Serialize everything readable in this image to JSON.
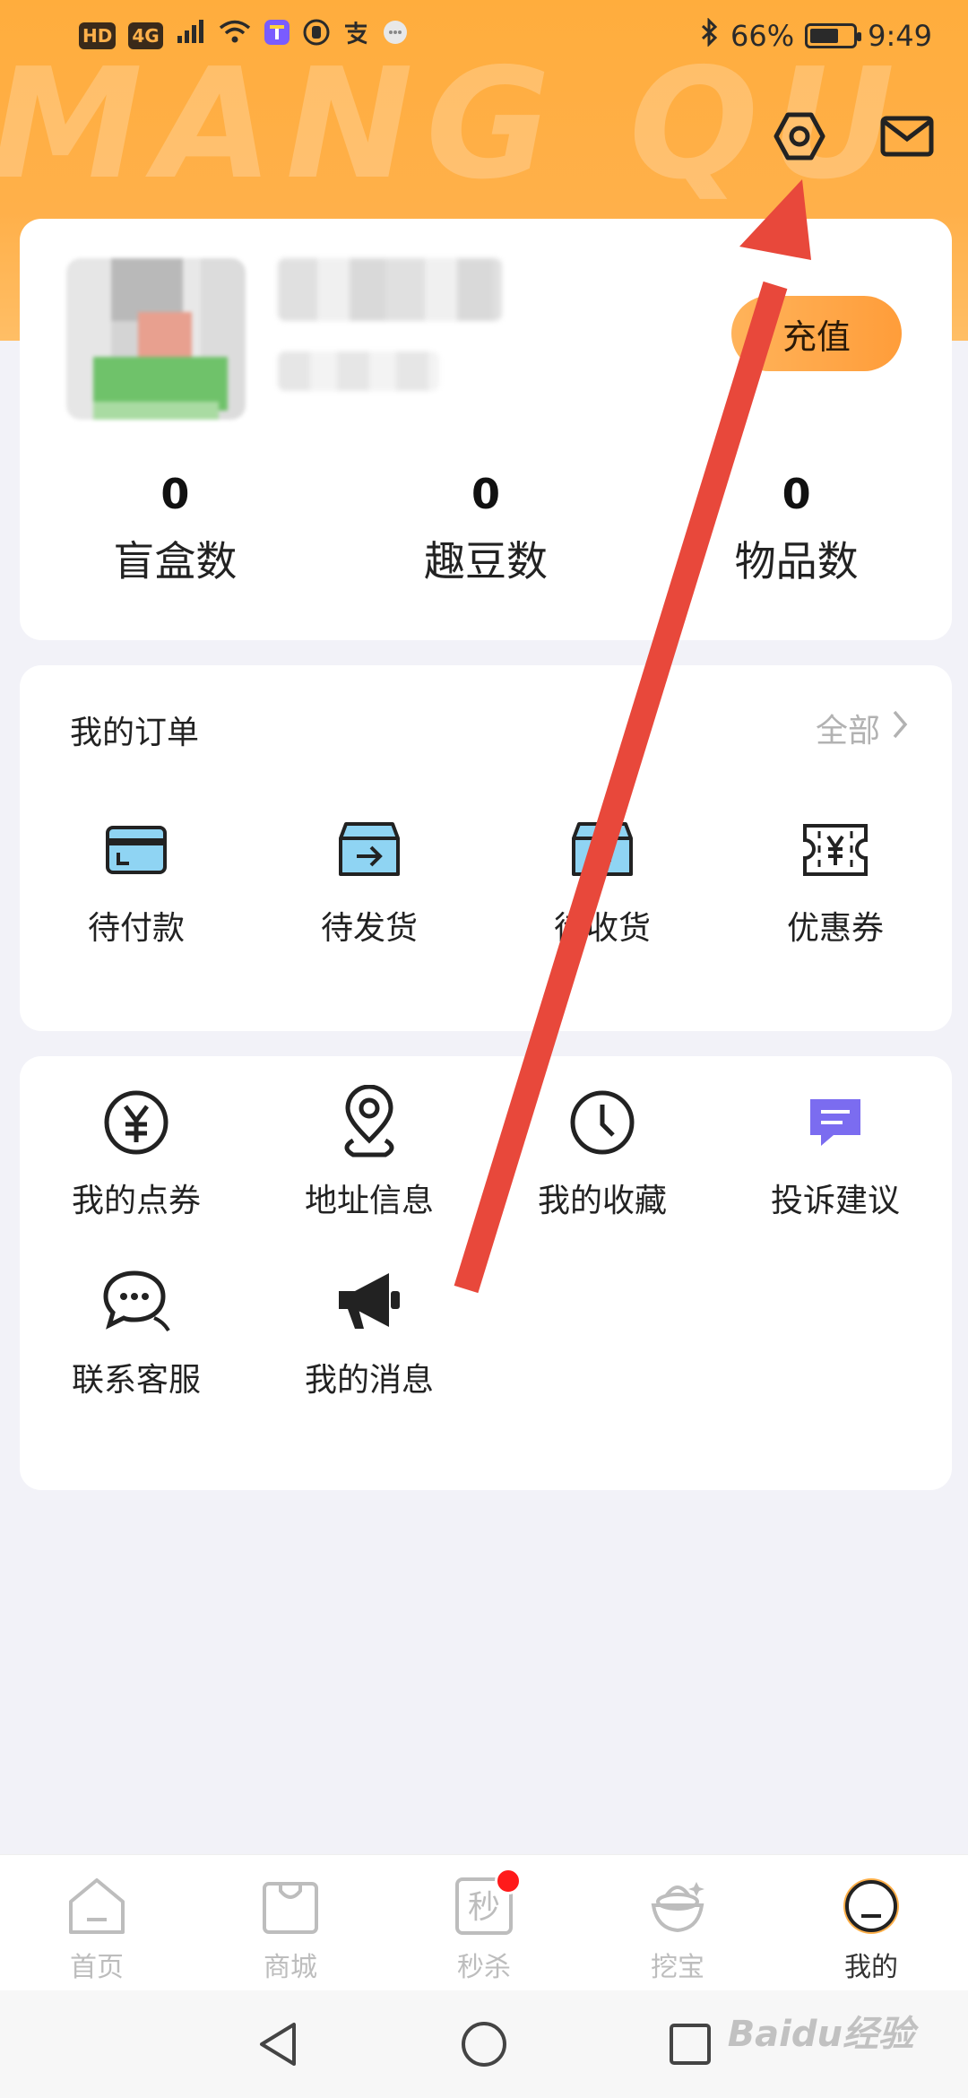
{
  "status_bar": {
    "left_chips": [
      "HD",
      "4G"
    ],
    "battery_percent_text": "66%",
    "battery_level": 0.66,
    "time": "9:49"
  },
  "header": {
    "watermark": "MANG QU",
    "settings_icon": "settings-hexagon-icon",
    "message_icon": "mail-icon"
  },
  "profile": {
    "recharge_label": "充值",
    "stats": [
      {
        "value": "0",
        "label": "盲盒数"
      },
      {
        "value": "0",
        "label": "趣豆数"
      },
      {
        "value": "0",
        "label": "物品数"
      }
    ]
  },
  "orders": {
    "title": "我的订单",
    "all_label": "全部",
    "items": [
      {
        "label": "待付款",
        "icon": "wallet-icon"
      },
      {
        "label": "待发货",
        "icon": "box-arrow-icon"
      },
      {
        "label": "待收货",
        "icon": "box-receive-icon"
      },
      {
        "label": "优惠券",
        "icon": "coupon-icon"
      }
    ]
  },
  "tools": {
    "items": [
      {
        "label": "我的点券",
        "icon": "yen-coin-icon"
      },
      {
        "label": "地址信息",
        "icon": "location-pin-icon"
      },
      {
        "label": "我的收藏",
        "icon": "clock-icon"
      },
      {
        "label": "投诉建议",
        "icon": "feedback-chat-icon"
      },
      {
        "label": "联系客服",
        "icon": "chat-bubbles-icon"
      },
      {
        "label": "我的消息",
        "icon": "megaphone-icon"
      }
    ]
  },
  "tabbar": {
    "items": [
      {
        "label": "首页",
        "icon": "home-icon"
      },
      {
        "label": "商城",
        "icon": "shopping-bag-icon"
      },
      {
        "label": "秒杀",
        "icon": "flash-sale-icon",
        "icon_char": "秒"
      },
      {
        "label": "挖宝",
        "icon": "treasure-icon"
      },
      {
        "label": "我的",
        "icon": "profile-icon"
      }
    ],
    "active_index": 4
  },
  "watermark_corner": "Baidu经验",
  "colors": {
    "header_orange": "#ffad3d",
    "recharge_orange": "#ff9d3a",
    "annotation_arrow": "#e8483b",
    "feedback_purple": "#7b6cf0",
    "badge_red": "#ff1a1a"
  }
}
